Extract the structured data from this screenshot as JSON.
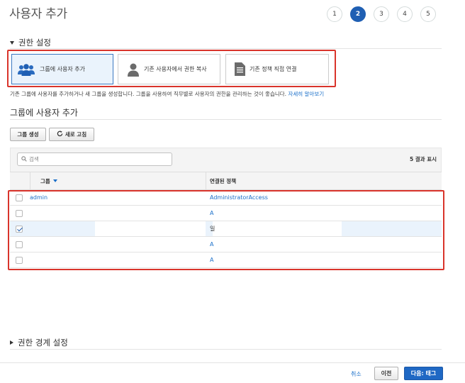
{
  "page": {
    "title": "사용자 추가"
  },
  "steps": [
    {
      "label": "1",
      "active": false
    },
    {
      "label": "2",
      "active": true
    },
    {
      "label": "3",
      "active": false
    },
    {
      "label": "4",
      "active": false
    },
    {
      "label": "5",
      "active": false
    }
  ],
  "permissions": {
    "section_title": "권한 설정",
    "options": [
      {
        "label": "그룹에 사용자 추가",
        "icon": "users-group-icon",
        "selected": true
      },
      {
        "label": "기존 사용자에서 권한 복사",
        "icon": "user-icon",
        "selected": false
      },
      {
        "label": "기존 정책 직접 연결",
        "icon": "document-icon",
        "selected": false
      }
    ],
    "help_text": "기존 그룹에 사용자를 추가하거나 새 그룹을 생성합니다. 그룹을 사용하여 직무별로 사용자의 권한을 관리하는 것이 좋습니다.",
    "help_link": "자세히 알아보기"
  },
  "groups": {
    "title": "그룹에 사용자 추가",
    "create_button": "그룹 생성",
    "refresh_button": "새로 고침",
    "search_placeholder": "검색",
    "result_count": "5 결과 표시",
    "columns": {
      "group": "그룹",
      "policy": "연결된 정책"
    },
    "rows": [
      {
        "name": "admin",
        "policy": "AdministratorAccess",
        "checked": false
      },
      {
        "name": "",
        "policy": "A",
        "checked": false
      },
      {
        "name": "",
        "policy": "일",
        "checked": true
      },
      {
        "name": "",
        "policy": "A",
        "checked": false
      },
      {
        "name": "",
        "policy": "A",
        "checked": false
      }
    ]
  },
  "boundary": {
    "section_title": "권한 경계 설정"
  },
  "footer": {
    "cancel": "취소",
    "prev": "이전",
    "next": "다음: 태그"
  },
  "colors": {
    "accent": "#1f68c4",
    "highlight_box": "#d9342b",
    "link": "#1a6fc9"
  }
}
